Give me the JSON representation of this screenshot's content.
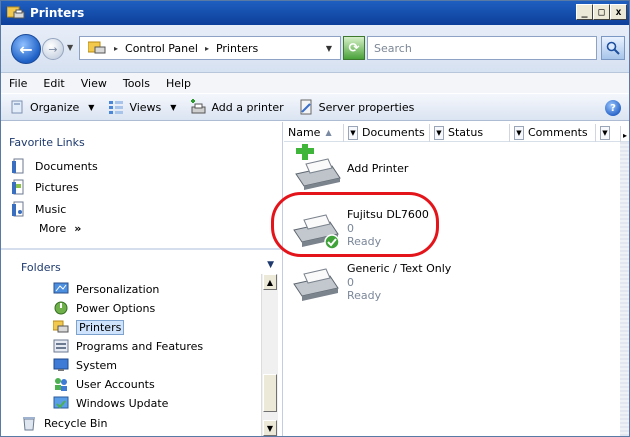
{
  "window": {
    "title": "Printers"
  },
  "window_buttons": {
    "minimize": "_",
    "maximize": "□",
    "close": "x"
  },
  "address": {
    "crumbs": [
      "Control Panel",
      "Printers"
    ],
    "separator": "▸"
  },
  "search": {
    "placeholder": "Search"
  },
  "menu": [
    "File",
    "Edit",
    "View",
    "Tools",
    "Help"
  ],
  "toolbar": {
    "organize": "Organize",
    "views": "Views",
    "add_printer": "Add a printer",
    "server_properties": "Server properties"
  },
  "favorites": {
    "title": "Favorite Links",
    "items": [
      "Documents",
      "Pictures",
      "Music"
    ],
    "more": "More",
    "more_glyph": "»"
  },
  "folders": {
    "title": "Folders",
    "items": [
      "Personalization",
      "Power Options",
      "Printers",
      "Programs and Features",
      "System",
      "User Accounts",
      "Windows Update"
    ],
    "recycle": "Recycle Bin",
    "selected": "Printers"
  },
  "columns": [
    "Name",
    "Documents",
    "Status",
    "Comments"
  ],
  "printers": [
    {
      "name": "Add Printer",
      "documents": "",
      "status": ""
    },
    {
      "name": "Fujitsu DL7600",
      "documents": "0",
      "status": "Ready",
      "default": true
    },
    {
      "name": "Generic / Text Only",
      "documents": "0",
      "status": "Ready"
    }
  ],
  "colors": {
    "title_bar": "#1f5fc0",
    "highlight_ring": "#e4141b",
    "selection": "#cfe3fd"
  },
  "icons": {
    "window": "printers-folder-icon",
    "back": "back-arrow-icon",
    "forward": "forward-arrow-icon",
    "refresh": "refresh-icon",
    "search": "magnifier-icon",
    "help": "help-icon"
  }
}
